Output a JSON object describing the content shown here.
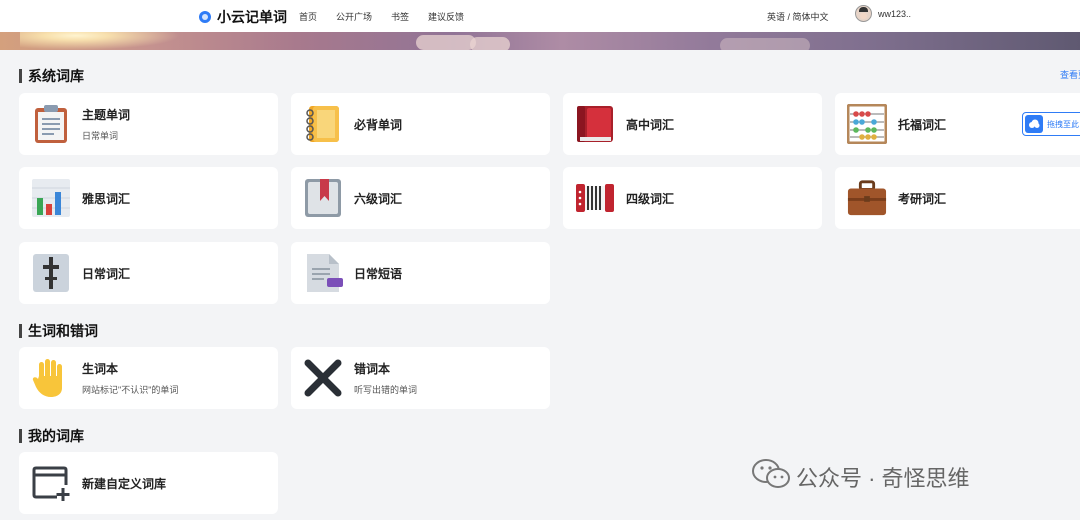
{
  "header": {
    "app_title": "小云记单词",
    "nav": [
      "首页",
      "公开广场",
      "书签",
      "建议反馈"
    ],
    "language": "英语 / 简体中文",
    "username": "ww123.."
  },
  "sections": {
    "system": {
      "title": "系统词库",
      "view_more": "查看更",
      "cards": [
        {
          "title": "主题单词",
          "subtitle": "日常单词",
          "icon": "clipboard-icon"
        },
        {
          "title": "必背单词",
          "subtitle": "",
          "icon": "notebook-icon"
        },
        {
          "title": "高中词汇",
          "subtitle": "",
          "icon": "red-book-icon"
        },
        {
          "title": "托福词汇",
          "subtitle": "",
          "icon": "abacus-icon"
        },
        {
          "title": "雅思词汇",
          "subtitle": "",
          "icon": "bar-chart-icon"
        },
        {
          "title": "六级词汇",
          "subtitle": "",
          "icon": "bookmark-book-icon"
        },
        {
          "title": "四级词汇",
          "subtitle": "",
          "icon": "accordion-icon"
        },
        {
          "title": "考研词汇",
          "subtitle": "",
          "icon": "briefcase-icon"
        },
        {
          "title": "日常词汇",
          "subtitle": "",
          "icon": "level-slider-icon"
        },
        {
          "title": "日常短语",
          "subtitle": "",
          "icon": "document-tag-icon"
        }
      ]
    },
    "review": {
      "title": "生词和错词",
      "cards": [
        {
          "title": "生词本",
          "subtitle": "网站标记\"不认识\"的单词",
          "icon": "raised-hand-icon"
        },
        {
          "title": "错词本",
          "subtitle": "听写出错的单词",
          "icon": "cross-mark-icon"
        }
      ]
    },
    "mine": {
      "title": "我的词库",
      "cards": [
        {
          "title": "新建自定义词库",
          "subtitle": "",
          "icon": "new-window-icon"
        }
      ]
    }
  },
  "drag_button": {
    "label": "拖拽至此"
  },
  "watermark": {
    "text": "公众号 · 奇怪思维"
  }
}
